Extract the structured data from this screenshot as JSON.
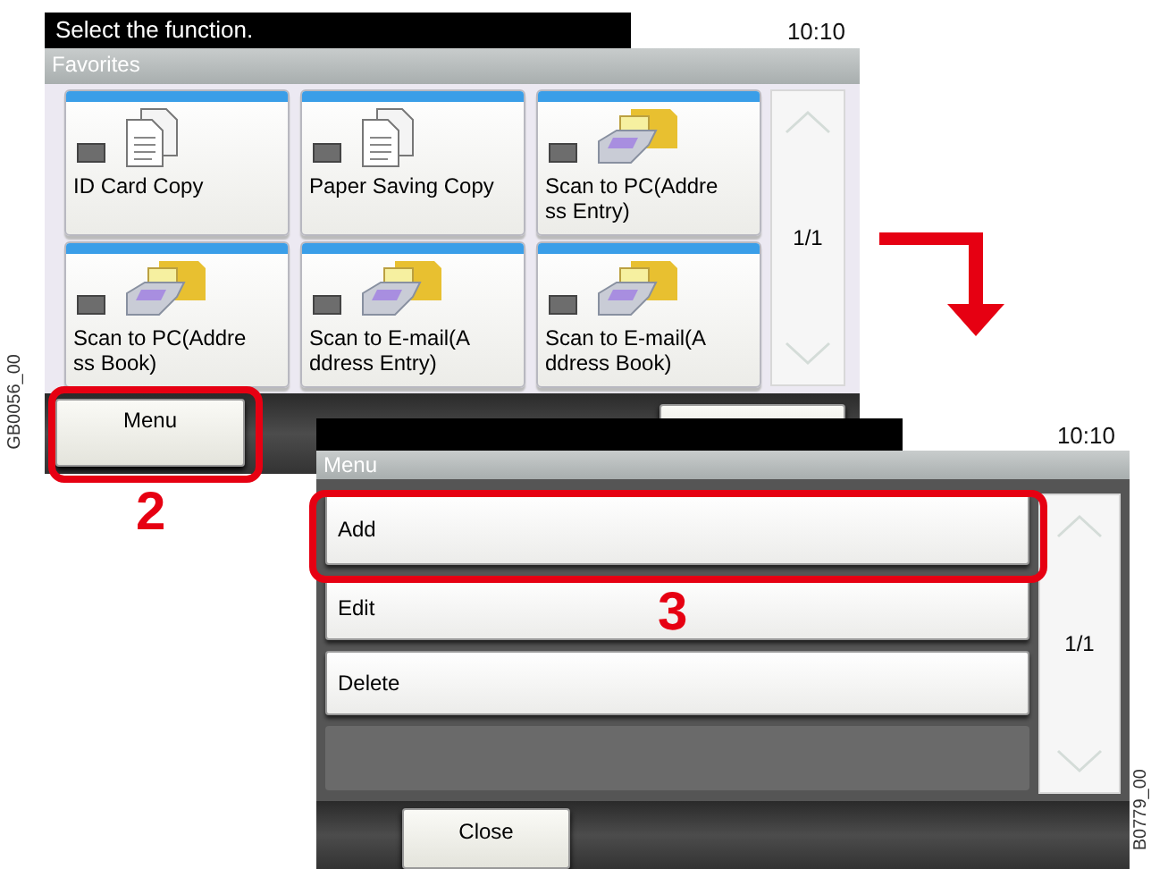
{
  "screen_1": {
    "title": "Select the function.",
    "time": "10:10",
    "section": "Favorites",
    "tiles": [
      {
        "label_lines": [
          "ID Card Copy"
        ],
        "kind": "copy"
      },
      {
        "label_lines": [
          "Paper Saving Copy"
        ],
        "kind": "copy"
      },
      {
        "label_lines": [
          "Scan to PC(Addre",
          "ss Entry)"
        ],
        "kind": "scan"
      },
      {
        "label_lines": [
          "Scan to PC(Addre",
          "ss Book)"
        ],
        "kind": "scan"
      },
      {
        "label_lines": [
          "Scan to E-mail(A",
          "ddress Entry)"
        ],
        "kind": "scan"
      },
      {
        "label_lines": [
          "Scan to E-mail(A",
          "ddress Book)"
        ],
        "kind": "scan"
      }
    ],
    "page": "1/1",
    "menu_button": "Menu"
  },
  "step_2": "2",
  "screen_2": {
    "time": "10:10",
    "section": "Menu",
    "items": [
      {
        "label": "Add",
        "highlighted": true
      },
      {
        "label": "Edit",
        "highlighted": false
      },
      {
        "label": "Delete",
        "highlighted": false
      }
    ],
    "page": "1/1",
    "close_button": "Close"
  },
  "step_3": "3",
  "figure_codes": [
    "GB0056_00",
    "B0779_00"
  ]
}
